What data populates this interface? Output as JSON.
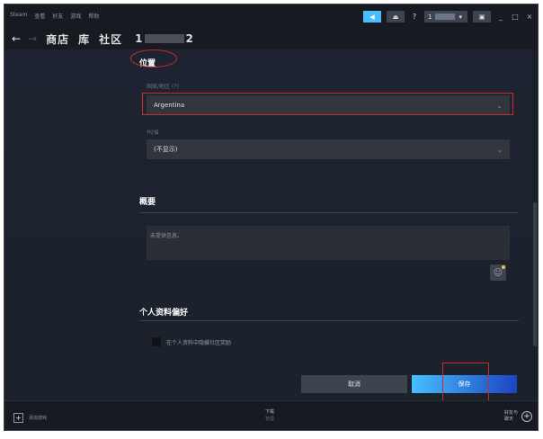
{
  "window": {
    "title": "Steam"
  },
  "menu": {
    "items": [
      "Steam",
      "查看",
      "好友",
      "游戏",
      "帮助"
    ]
  },
  "titlebar": {
    "help_label": "?",
    "user_initial": "1",
    "minimize": "_",
    "maximize": "□",
    "close": "×"
  },
  "nav": {
    "store": "商店",
    "library": "库",
    "community": "社区",
    "user_prefix": "1",
    "user_suffix": "2"
  },
  "location": {
    "section_title": "位置",
    "country_label": "国家/地区 (?)",
    "country_value": "Argentina",
    "state_label": "州/省",
    "state_value": "(不显示)"
  },
  "summary": {
    "section_title": "概要",
    "textarea_value": "未提供信息。"
  },
  "preferences": {
    "section_title": "个人资料偏好",
    "checkbox_label": "在个人资料中隐藏社区奖励"
  },
  "actions": {
    "cancel_label": "取消",
    "save_label": "保存"
  },
  "bottombar": {
    "add_game": "添加游戏",
    "downloads_line1": "下载",
    "downloads_line2": "管理",
    "friends_line1": "好友与",
    "friends_line2": "聊天"
  },
  "colors": {
    "accent_blue": "#47bfff",
    "save_gradient_end": "#1a44c2",
    "annotation_red": "#d12a2a",
    "content_bg": "#1d2330"
  },
  "icons": {
    "back": "arrow-left-icon",
    "forward": "arrow-right-icon",
    "chevron": "chevron-down-icon",
    "emoji": "emoji-icon",
    "add": "plus-icon"
  }
}
